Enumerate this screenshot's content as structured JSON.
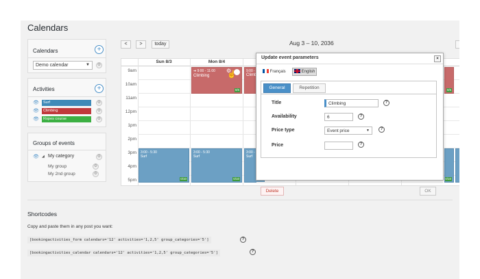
{
  "page": {
    "title": "Calendars"
  },
  "sidebar": {
    "calendars": {
      "title": "Calendars",
      "selected": "Demo calendar"
    },
    "activities": {
      "title": "Activities",
      "items": [
        {
          "label": "Surf",
          "color": "#3f8ab8"
        },
        {
          "label": "Climbing",
          "color": "#c0393b"
        },
        {
          "label": "Ropes course",
          "color": "#3cb043"
        }
      ]
    },
    "groups": {
      "title": "Groups of events",
      "category": "My category",
      "items": [
        "My group",
        "My 2nd group"
      ]
    }
  },
  "calendar": {
    "nav": {
      "prev": "<",
      "next": ">",
      "today": "today"
    },
    "range": "Aug 3 – 10, 2036",
    "days": [
      "Sun 8/3",
      "Mon 8/4"
    ],
    "times": [
      "9am",
      "10am",
      "11am",
      "12pm",
      "1pm",
      "2pm",
      "3pm",
      "4pm",
      "5pm"
    ],
    "events": {
      "climbing": {
        "time": "9:00 - 11:00",
        "title": "Climbing",
        "avail": "0/6"
      },
      "climbing_partial": {
        "time": "9:00 - 1",
        "title": "Climb"
      },
      "surf": {
        "time": "3:00 - 5:30",
        "title": "Surf",
        "avail": "0/10"
      },
      "avail_right": "0/6"
    }
  },
  "modal": {
    "title": "Update event parameters",
    "close": "×",
    "languages": [
      {
        "label": "Français",
        "flag": "fr"
      },
      {
        "label": "English",
        "flag": "gb"
      }
    ],
    "tabs": [
      "General",
      "Repetition"
    ],
    "fields": {
      "title": {
        "label": "Title",
        "value": "Climbing"
      },
      "availability": {
        "label": "Availability",
        "value": "6"
      },
      "price_type": {
        "label": "Price type",
        "value": "Event price"
      },
      "price": {
        "label": "Price",
        "value": ""
      }
    },
    "buttons": {
      "delete": "Delete",
      "ok": "OK"
    }
  },
  "shortcodes": {
    "title": "Shortcodes",
    "description": "Copy and paste them in any post you want:",
    "form_code": "[bookingactivities_form calendars='12' activities='1,2,5' group_categories='5']",
    "calendar_code": "[bookingactivities_calendar calendars='12' activities='1,2,5' group_categories='5']"
  },
  "colors": {
    "accent": "#4a90c8",
    "event_blue": "#6ca0c4",
    "event_red": "#c76a6a",
    "delete_text": "#c0392b"
  }
}
